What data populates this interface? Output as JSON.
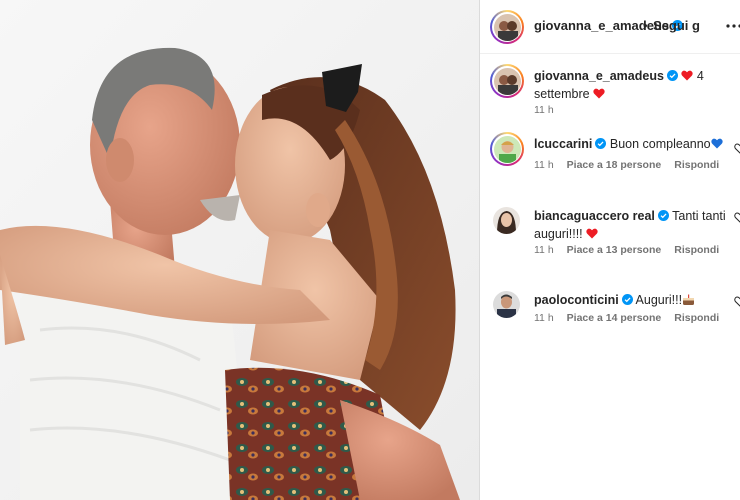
{
  "post": {
    "author": "giovanna_e_amadeus",
    "follow_label": "Segui g",
    "separator": "•",
    "photo_alt": "Photo of a couple kissing"
  },
  "comments": [
    {
      "username": "giovanna_e_amadeus",
      "verified": true,
      "text": "4 settembre",
      "time": "11 h",
      "likes": "",
      "reply": ""
    },
    {
      "username": "lcuccarini",
      "verified": true,
      "text": "Buon compleanno",
      "time": "11 h",
      "likes": "Piace a 18 persone",
      "reply": "Rispondi"
    },
    {
      "username": "biancaguaccero real",
      "verified": true,
      "text": "Tanti tanti auguri!!!!",
      "time": "11 h",
      "likes": "Piace a 13 persone",
      "reply": "Rispondi"
    },
    {
      "username": "paoloconticini",
      "verified": true,
      "text": "Auguri!!!",
      "time": "11 h",
      "likes": "Piace a 14 persone",
      "reply": "Rispondi"
    }
  ],
  "colors": {
    "verified_blue": "#0095f6",
    "heart_red": "#ed1c24",
    "heart_blue": "#1d6fd8",
    "meta_gray": "#737373"
  },
  "icons": {
    "more": "more-options-icon",
    "verified": "verified-badge-icon",
    "heart_outline": "heart-outline-icon"
  }
}
